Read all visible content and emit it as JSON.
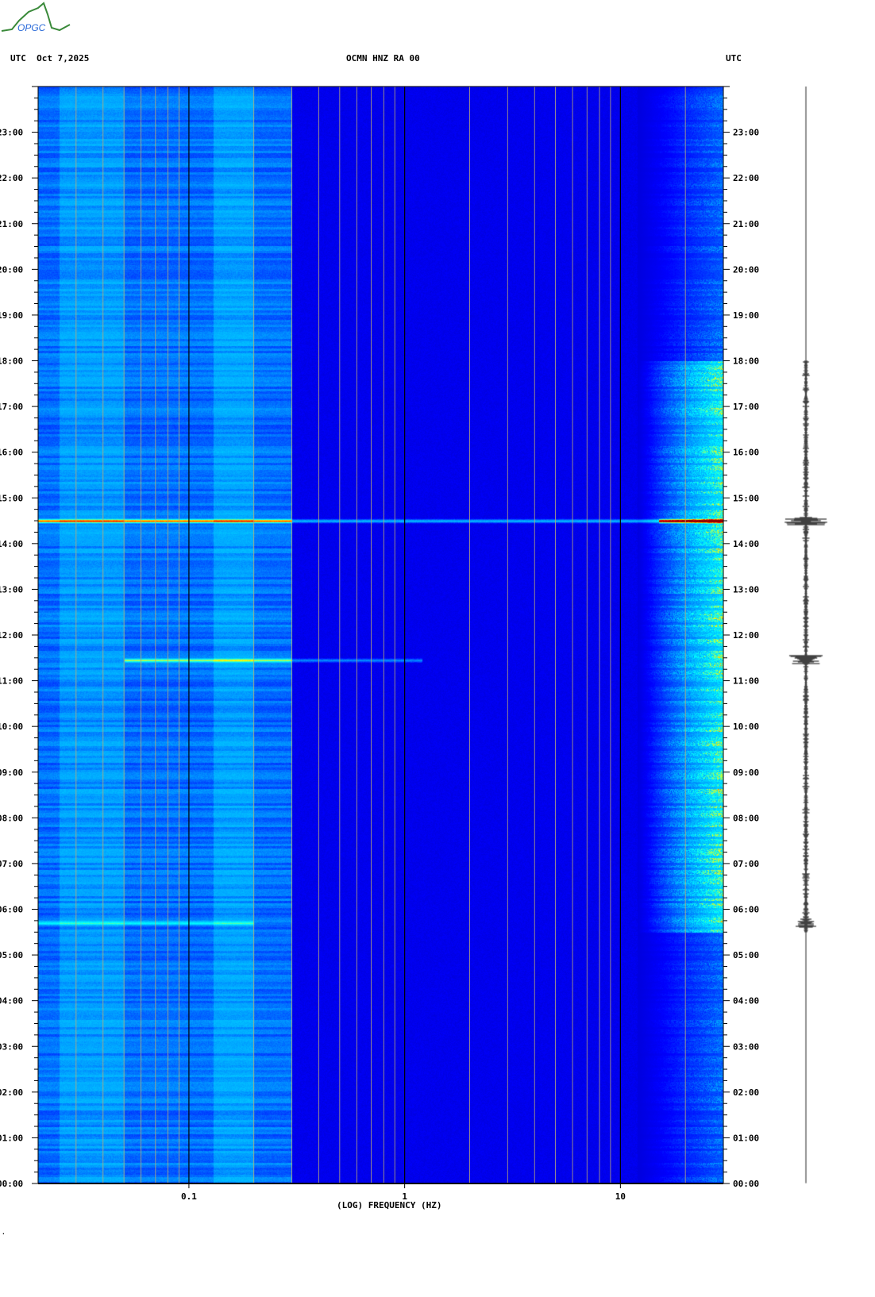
{
  "header": {
    "logo_text": "OPGC",
    "left_label": "UTC  Oct 7,2025",
    "center_label": "OCMN HNZ RA 00",
    "right_label": "UTC"
  },
  "footer_mark": "·",
  "chart_data": {
    "type": "heatmap",
    "title": "OCMN HNZ RA 00",
    "date": "Oct 7,2025",
    "xlabel": "(LOG) FREQUENCY (HZ)",
    "ylabel": "UTC",
    "xscale": "log",
    "xlim": [
      0.02,
      30
    ],
    "ylim": [
      0,
      24
    ],
    "x_ticks": [
      {
        "value": 0.1,
        "label": "0.1"
      },
      {
        "value": 1,
        "label": "1"
      },
      {
        "value": 10,
        "label": "10"
      }
    ],
    "y_ticks": [
      "00:00",
      "01:00",
      "02:00",
      "03:00",
      "04:00",
      "05:00",
      "06:00",
      "07:00",
      "08:00",
      "09:00",
      "10:00",
      "11:00",
      "12:00",
      "13:00",
      "14:00",
      "15:00",
      "16:00",
      "17:00",
      "18:00",
      "19:00",
      "20:00",
      "21:00",
      "22:00",
      "23:00"
    ],
    "colormap": [
      "#00008c",
      "#0000ff",
      "#00a0ff",
      "#00ffff",
      "#ffff00",
      "#ff0000",
      "#8c0000"
    ],
    "events": [
      {
        "time_h": 14.5,
        "fmin": 0.02,
        "fmax": 30,
        "strength": 1.0
      },
      {
        "time_h": 11.45,
        "fmin": 0.05,
        "fmax": 1.2,
        "strength": 0.75
      },
      {
        "time_h": 5.7,
        "fmin": 0.02,
        "fmax": 0.2,
        "strength": 0.45
      }
    ],
    "high_frequency_noise_hours": [
      5.5,
      18
    ]
  }
}
